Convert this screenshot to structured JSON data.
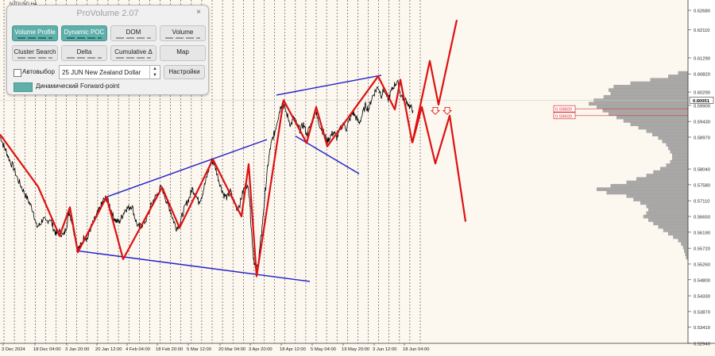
{
  "symbol": "NZDUSD,H4",
  "panel": {
    "title": "ProVolume 2.07",
    "close": "×",
    "buttons": [
      {
        "label": "Volume Profile",
        "active": true
      },
      {
        "label": "Dynamic POC",
        "active": true
      },
      {
        "label": "DOM",
        "active": false
      },
      {
        "label": "Volume",
        "active": false
      },
      {
        "label": "Cluster Search",
        "active": false
      },
      {
        "label": "Delta",
        "active": false
      },
      {
        "label": "Cumulative Δ",
        "active": false
      },
      {
        "label": "Map",
        "active": false
      }
    ],
    "autoselect_label": "Автовыбор",
    "contract": "25 JUN New Zealand Dollar",
    "settings_label": "Настройки",
    "forward_point_label": "Динамический Forward-point"
  },
  "chart_data": {
    "type": "line",
    "ylim": [
      0.5294,
      0.6268
    ],
    "price_ticks": [
      "0.62680",
      "0.62110",
      "0.61290",
      "0.60820",
      "0.60290",
      "0.59900",
      "0.59430",
      "0.58970",
      "0.58040",
      "0.57580",
      "0.57110",
      "0.56650",
      "0.56190",
      "0.55720",
      "0.55260",
      "0.54800",
      "0.54330",
      "0.53870",
      "0.53410",
      "0.52940"
    ],
    "time_labels": [
      "3 Dec 2024",
      "18 Dec 04:00",
      "3 Jan 20:00",
      "20 Jan 12:00",
      "4 Feb 04:00",
      "18 Feb 20:00",
      "5 Mar 12:00",
      "20 Mar 04:00",
      "3 Apr 20:00",
      "18 Apr 12:00",
      "5 May 04:00",
      "19 May 20:00",
      "3 Jun 12:00",
      "18 Jun 04:00"
    ],
    "current_price": "0.60051",
    "levels": [
      {
        "label": "0.59800",
        "price": 0.598,
        "color": "#d93030"
      },
      {
        "label": "0.59600",
        "price": 0.596,
        "color": "#d93030"
      }
    ],
    "price_path": [
      [
        0,
        0.5905
      ],
      [
        4,
        0.5875
      ],
      [
        8,
        0.5855
      ],
      [
        12,
        0.583
      ],
      [
        17,
        0.5808
      ],
      [
        22,
        0.5776
      ],
      [
        27,
        0.5752
      ],
      [
        32,
        0.5728
      ],
      [
        37,
        0.5705
      ],
      [
        42,
        0.568
      ],
      [
        46,
        0.5635
      ],
      [
        50,
        0.564
      ],
      [
        54,
        0.5658
      ],
      [
        58,
        0.5648
      ],
      [
        63,
        0.566
      ],
      [
        67,
        0.5632
      ],
      [
        71,
        0.5612
      ],
      [
        75,
        0.562
      ],
      [
        80,
        0.5608
      ],
      [
        84,
        0.564
      ],
      [
        87,
        0.5682
      ],
      [
        90,
        0.5655
      ],
      [
        94,
        0.5612
      ],
      [
        98,
        0.557
      ],
      [
        102,
        0.558
      ],
      [
        106,
        0.5606
      ],
      [
        110,
        0.56
      ],
      [
        114,
        0.563
      ],
      [
        118,
        0.565
      ],
      [
        122,
        0.567
      ],
      [
        126,
        0.569
      ],
      [
        130,
        0.5712
      ],
      [
        134,
        0.5718
      ],
      [
        138,
        0.5698
      ],
      [
        142,
        0.5668
      ],
      [
        146,
        0.5652
      ],
      [
        150,
        0.5648
      ],
      [
        154,
        0.5668
      ],
      [
        158,
        0.5688
      ],
      [
        162,
        0.569
      ],
      [
        166,
        0.5698
      ],
      [
        170,
        0.566
      ],
      [
        174,
        0.5632
      ],
      [
        178,
        0.564
      ],
      [
        182,
        0.5648
      ],
      [
        186,
        0.5666
      ],
      [
        190,
        0.5696
      ],
      [
        194,
        0.5716
      ],
      [
        198,
        0.573
      ],
      [
        202,
        0.5748
      ],
      [
        206,
        0.5738
      ],
      [
        210,
        0.5705
      ],
      [
        214,
        0.5686
      ],
      [
        218,
        0.5655
      ],
      [
        222,
        0.5632
      ],
      [
        226,
        0.5642
      ],
      [
        230,
        0.5672
      ],
      [
        234,
        0.57
      ],
      [
        238,
        0.5718
      ],
      [
        242,
        0.5746
      ],
      [
        246,
        0.5732
      ],
      [
        250,
        0.5708
      ],
      [
        254,
        0.5726
      ],
      [
        258,
        0.576
      ],
      [
        262,
        0.5795
      ],
      [
        266,
        0.583
      ],
      [
        270,
        0.5818
      ],
      [
        274,
        0.5784
      ],
      [
        278,
        0.5752
      ],
      [
        282,
        0.5728
      ],
      [
        286,
        0.572
      ],
      [
        290,
        0.5738
      ],
      [
        294,
        0.5712
      ],
      [
        298,
        0.569
      ],
      [
        302,
        0.5702
      ],
      [
        306,
        0.5738
      ],
      [
        310,
        0.5762
      ],
      [
        314,
        0.573
      ],
      [
        316,
        0.564
      ],
      [
        319,
        0.555
      ],
      [
        322,
        0.5502
      ],
      [
        325,
        0.553
      ],
      [
        328,
        0.559
      ],
      [
        331,
        0.566
      ],
      [
        334,
        0.574
      ],
      [
        337,
        0.581
      ],
      [
        340,
        0.5862
      ],
      [
        343,
        0.5892
      ],
      [
        346,
        0.5912
      ],
      [
        349,
        0.5945
      ],
      [
        352,
        0.5975
      ],
      [
        355,
        0.6
      ],
      [
        358,
        0.5985
      ],
      [
        362,
        0.5958
      ],
      [
        366,
        0.5932
      ],
      [
        370,
        0.5955
      ],
      [
        374,
        0.593
      ],
      [
        378,
        0.5918
      ],
      [
        382,
        0.5935
      ],
      [
        386,
        0.5905
      ],
      [
        390,
        0.5925
      ],
      [
        394,
        0.595
      ],
      [
        397,
        0.5975
      ],
      [
        400,
        0.5948
      ],
      [
        404,
        0.5925
      ],
      [
        408,
        0.5908
      ],
      [
        412,
        0.5885
      ],
      [
        416,
        0.59
      ],
      [
        420,
        0.5912
      ],
      [
        424,
        0.5895
      ],
      [
        428,
        0.5918
      ],
      [
        432,
        0.5938
      ],
      [
        436,
        0.5922
      ],
      [
        440,
        0.5948
      ],
      [
        444,
        0.597
      ],
      [
        448,
        0.5955
      ],
      [
        452,
        0.5938
      ],
      [
        456,
        0.5962
      ],
      [
        460,
        0.599
      ],
      [
        464,
        0.5978
      ],
      [
        468,
        0.6012
      ],
      [
        472,
        0.603
      ],
      [
        476,
        0.6045
      ],
      [
        480,
        0.602
      ],
      [
        484,
        0.6038
      ],
      [
        488,
        0.6005
      ],
      [
        492,
        0.6028
      ],
      [
        496,
        0.6048
      ],
      [
        500,
        0.606
      ],
      [
        504,
        0.6025
      ],
      [
        508,
        0.6008
      ],
      [
        512,
        0.6002
      ],
      [
        516,
        0.5985
      ],
      [
        520,
        0.5975
      ]
    ],
    "zigzag_main": [
      [
        0,
        0.5905
      ],
      [
        48,
        0.5752
      ],
      [
        75,
        0.5608
      ],
      [
        88,
        0.5692
      ],
      [
        98,
        0.556
      ],
      [
        134,
        0.5722
      ],
      [
        155,
        0.554
      ],
      [
        204,
        0.575
      ],
      [
        226,
        0.5632
      ],
      [
        268,
        0.5832
      ],
      [
        304,
        0.5665
      ],
      [
        313,
        0.5818
      ],
      [
        323,
        0.549
      ],
      [
        357,
        0.6005
      ],
      [
        386,
        0.588
      ],
      [
        398,
        0.5985
      ],
      [
        412,
        0.587
      ],
      [
        476,
        0.6075
      ],
      [
        497,
        0.5978
      ],
      [
        504,
        0.6065
      ],
      [
        519,
        0.588
      ]
    ],
    "zigzag_projection": [
      [
        519,
        0.588
      ],
      [
        541,
        0.612
      ],
      [
        552,
        0.5992
      ],
      [
        575,
        0.624
      ]
    ],
    "zigzag_projection_down": [
      [
        519,
        0.588
      ],
      [
        531,
        0.5985
      ],
      [
        548,
        0.582
      ],
      [
        566,
        0.596
      ],
      [
        586,
        0.565
      ]
    ],
    "trendlines": [
      {
        "from": [
          134,
          0.5722
        ],
        "to": [
          336,
          0.589
        ]
      },
      {
        "from": [
          96,
          0.5565
        ],
        "to": [
          390,
          0.5475
        ]
      },
      {
        "from": [
          348,
          0.602
        ],
        "to": [
          480,
          0.6078
        ]
      },
      {
        "from": [
          372,
          0.59
        ],
        "to": [
          452,
          0.579
        ]
      }
    ],
    "volume_profile": [
      [
        0.6085,
        0.1
      ],
      [
        0.6075,
        0.2
      ],
      [
        0.6065,
        0.38
      ],
      [
        0.6055,
        0.58
      ],
      [
        0.6045,
        0.75
      ],
      [
        0.6035,
        0.8
      ],
      [
        0.6025,
        0.78
      ],
      [
        0.6015,
        0.85
      ],
      [
        0.6005,
        0.95
      ],
      [
        0.5995,
        1.0
      ],
      [
        0.5985,
        0.92
      ],
      [
        0.5975,
        0.86
      ],
      [
        0.5965,
        0.8
      ],
      [
        0.5955,
        0.72
      ],
      [
        0.5945,
        0.65
      ],
      [
        0.5935,
        0.58
      ],
      [
        0.5925,
        0.5
      ],
      [
        0.5915,
        0.42
      ],
      [
        0.5905,
        0.36
      ],
      [
        0.5895,
        0.3
      ],
      [
        0.5885,
        0.26
      ],
      [
        0.5875,
        0.22
      ],
      [
        0.5865,
        0.2
      ],
      [
        0.5855,
        0.18
      ],
      [
        0.5845,
        0.16
      ],
      [
        0.5835,
        0.16
      ],
      [
        0.5825,
        0.18
      ],
      [
        0.5815,
        0.22
      ],
      [
        0.5805,
        0.28
      ],
      [
        0.5795,
        0.35
      ],
      [
        0.5785,
        0.42
      ],
      [
        0.5775,
        0.52
      ],
      [
        0.5765,
        0.62
      ],
      [
        0.5755,
        0.78
      ],
      [
        0.5745,
        0.92
      ],
      [
        0.5735,
        0.82
      ],
      [
        0.5725,
        0.62
      ],
      [
        0.5715,
        0.55
      ],
      [
        0.5705,
        0.48
      ],
      [
        0.5695,
        0.42
      ],
      [
        0.5685,
        0.4
      ],
      [
        0.5675,
        0.42
      ],
      [
        0.5665,
        0.45
      ],
      [
        0.5655,
        0.4
      ],
      [
        0.5645,
        0.35
      ],
      [
        0.5635,
        0.3
      ],
      [
        0.5625,
        0.25
      ],
      [
        0.5615,
        0.2
      ],
      [
        0.5605,
        0.15
      ],
      [
        0.5595,
        0.1
      ],
      [
        0.5585,
        0.07
      ],
      [
        0.5575,
        0.05
      ],
      [
        0.5565,
        0.04
      ],
      [
        0.5555,
        0.03
      ],
      [
        0.5545,
        0.02
      ]
    ]
  }
}
